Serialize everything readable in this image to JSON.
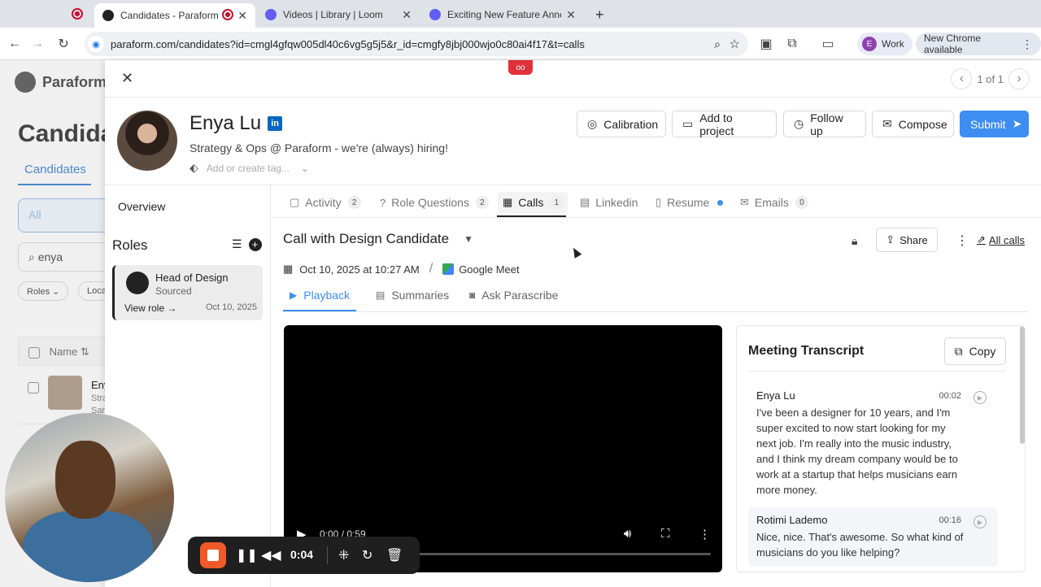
{
  "browser": {
    "tabs": [
      {
        "title": "Candidates - Paraform"
      },
      {
        "title": "Videos | Library | Loom"
      },
      {
        "title": "Exciting New Feature Announ"
      }
    ],
    "url": "paraform.com/candidates?id=cmgl4gfqw005dl40c6vg5g5j5&r_id=cmgfy8jbj000wjo0c80ai4f17&t=calls",
    "profile_label": "Work",
    "profile_initial": "E",
    "update_label": "New Chrome available"
  },
  "background": {
    "logo": "Paraform",
    "title": "Candida",
    "tab": "Candidates",
    "select": "All",
    "search": "enya",
    "chips": [
      "Roles",
      "Loca"
    ],
    "col_name": "Name",
    "row_name": "Eny",
    "row_sub1": "Stra",
    "row_sub2": "San"
  },
  "drawer": {
    "pager": "1 of 1",
    "loom_badge": "oo",
    "candidate": {
      "name": "Enya Lu",
      "headline": "Strategy & Ops @ Paraform - we're (always) hiring!",
      "tag_placeholder": "Add or create tag..."
    },
    "actions": {
      "calibration": "Calibration",
      "add_to_project": "Add to project",
      "follow_up": "Follow up",
      "compose": "Compose",
      "submit": "Submit"
    },
    "left": {
      "overview": "Overview",
      "roles_title": "Roles",
      "role": {
        "title": "Head of Design",
        "status": "Sourced",
        "view": "View role →",
        "date": "Oct 10, 2025"
      }
    },
    "tabs": [
      {
        "label": "Activity",
        "count": "2"
      },
      {
        "label": "Role Questions",
        "count": "2"
      },
      {
        "label": "Calls",
        "count": "1"
      },
      {
        "label": "Linkedin"
      },
      {
        "label": "Resume"
      },
      {
        "label": "Emails",
        "count": "0"
      }
    ],
    "call": {
      "title": "Call with Design Candidate",
      "share": "Share",
      "all_calls": "All calls",
      "datetime": "Oct 10, 2025 at 10:27 AM",
      "platform": "Google Meet",
      "subtabs": [
        "Playback",
        "Summaries",
        "Ask Parascribe"
      ],
      "video_time": "0:00 / 0:59"
    },
    "transcript": {
      "title": "Meeting Transcript",
      "copy": "Copy",
      "entries": [
        {
          "speaker": "Enya Lu",
          "time": "00:02",
          "text": "I've been a designer for 10 years, and I'm super excited to now start looking for my next job. I'm really into the music industry, and I think my dream company would be to work at a startup that helps musicians earn more money."
        },
        {
          "speaker": "Rotimi Lademo",
          "time": "00:16",
          "text": "Nice, nice. That's awesome. So what kind of musicians do you like helping?"
        }
      ]
    }
  },
  "recorder": {
    "time": "0:04"
  }
}
